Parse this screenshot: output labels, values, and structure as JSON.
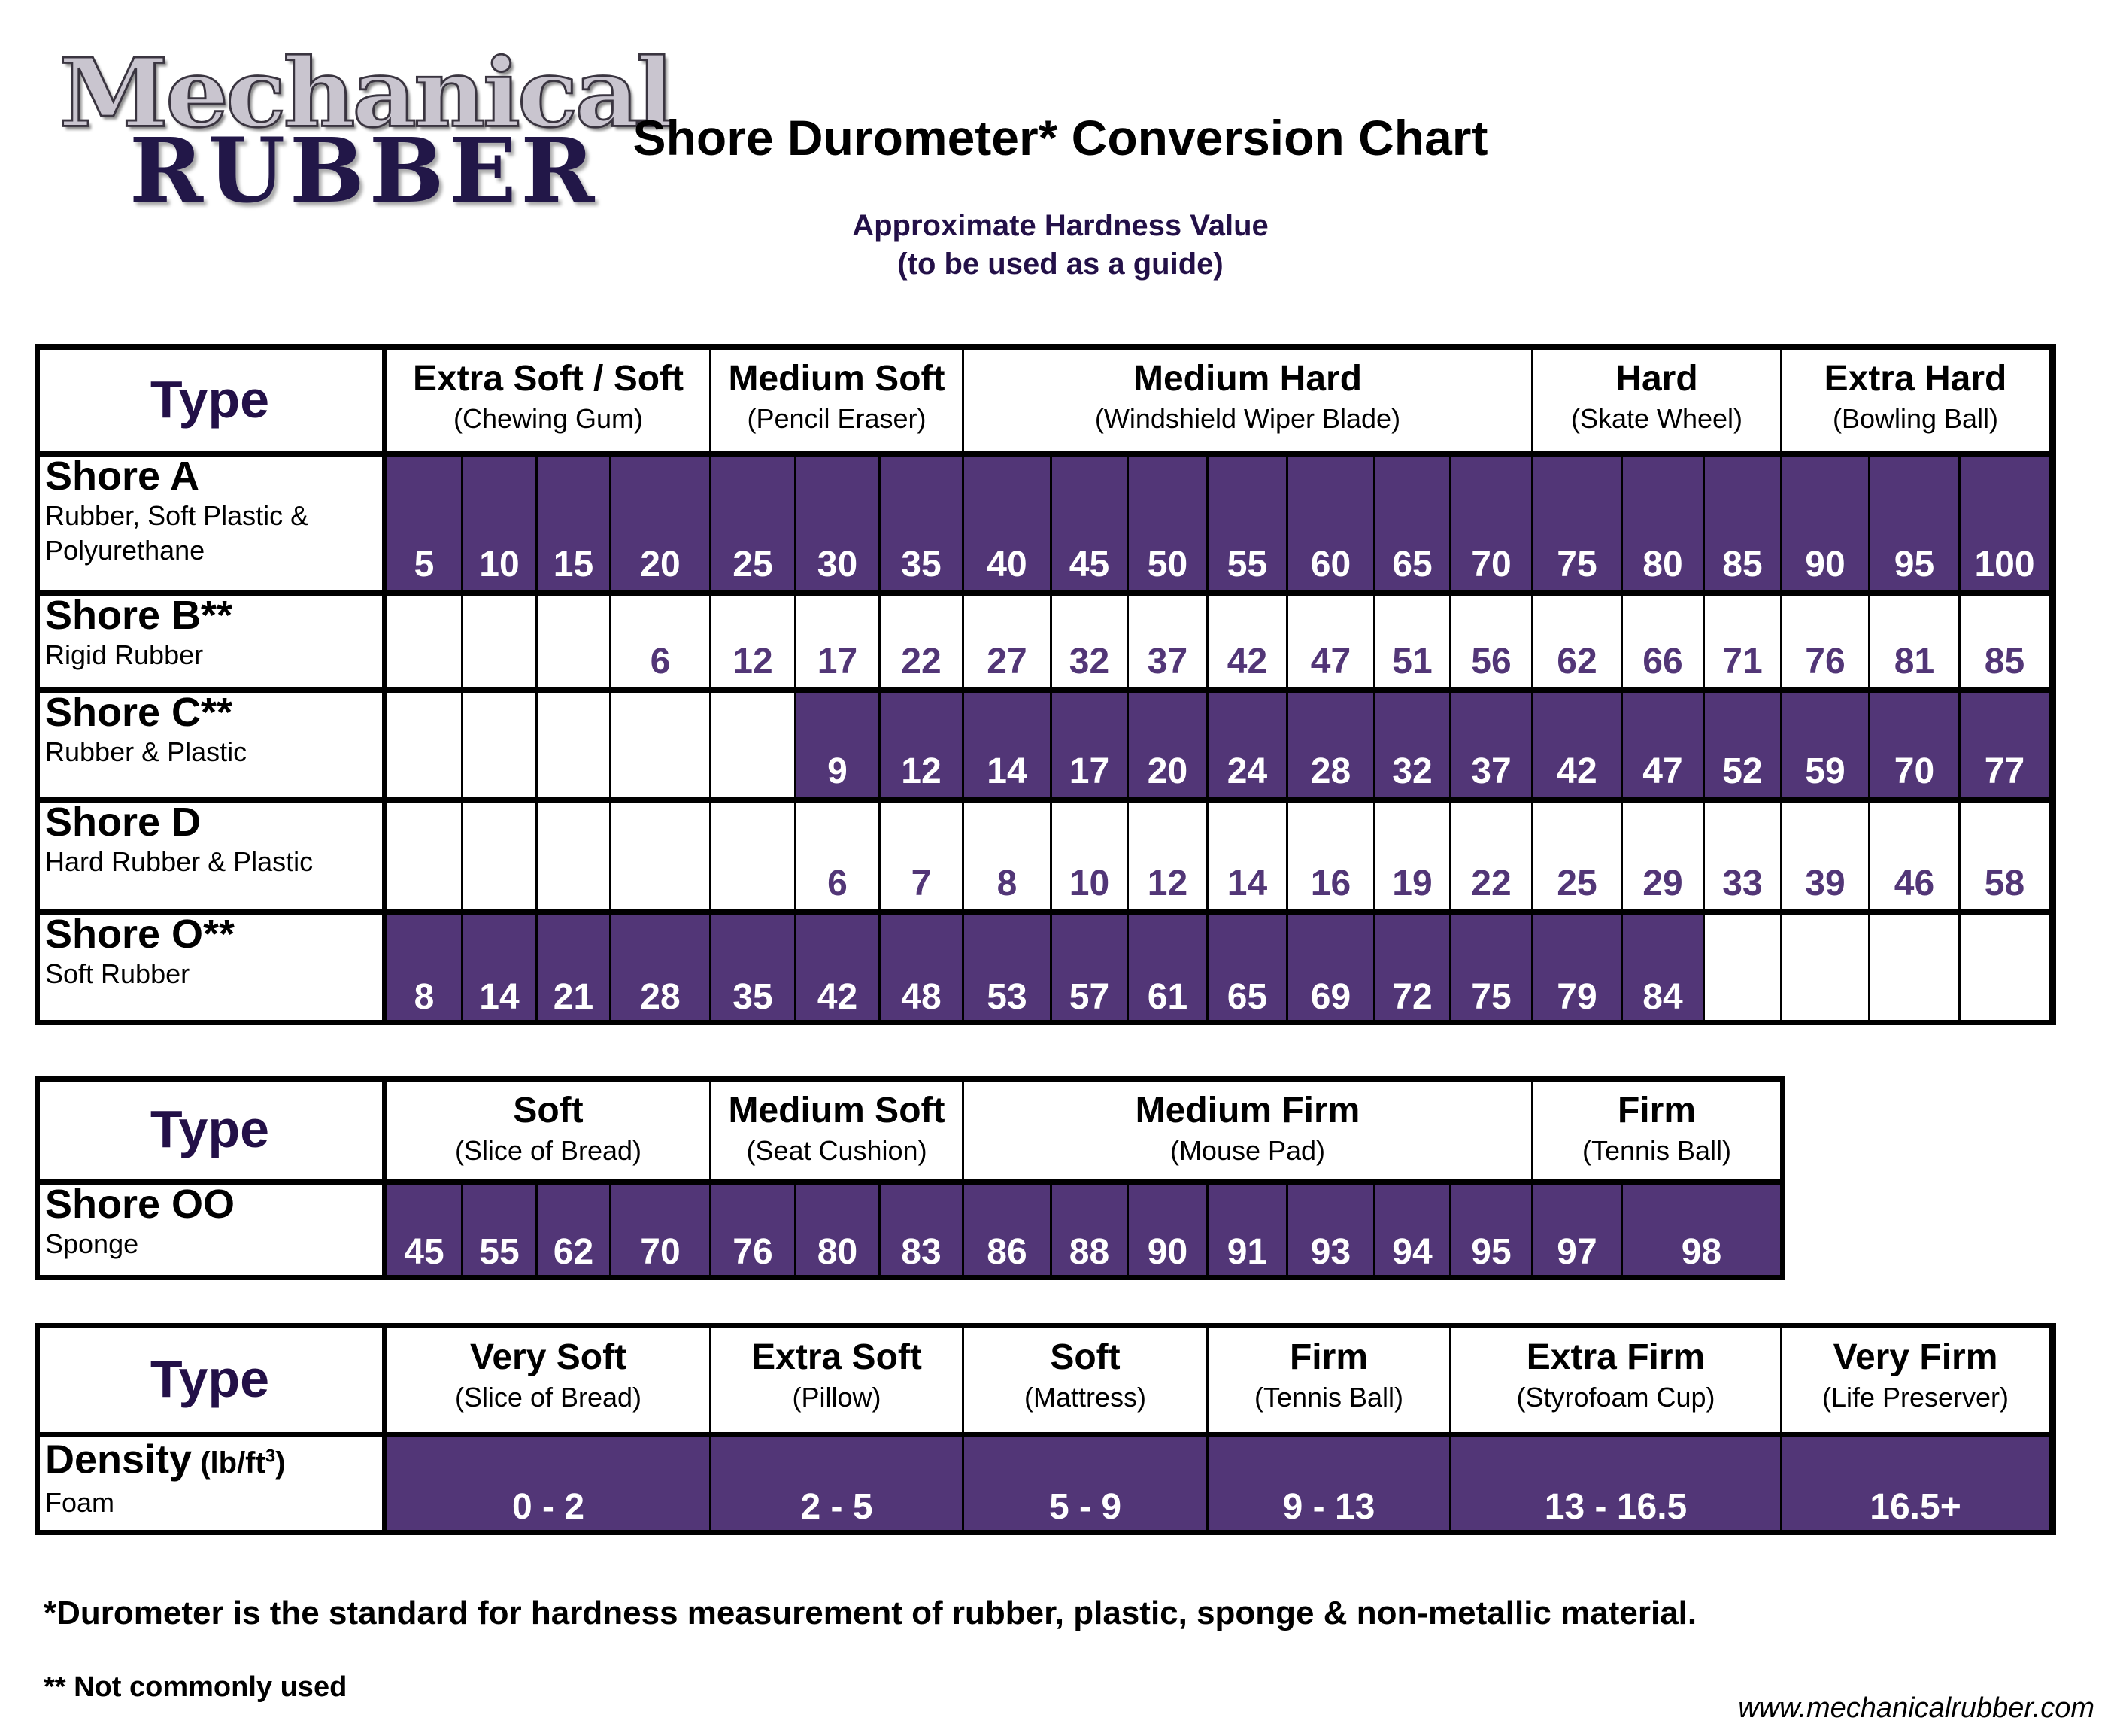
{
  "brand": {
    "logo_line1": "Mechanical",
    "logo_line2": "RUBBER"
  },
  "colors": {
    "accent_purple": "#523677",
    "type_text": "#231048",
    "logo_dark": "#221748",
    "logo_light": "#c9c5cf"
  },
  "header": {
    "title": "Shore Durometer* Conversion Chart",
    "subtitle_line1": "Approximate Hardness Value",
    "subtitle_line2": "(to be used as a guide)"
  },
  "shore_table": {
    "type_label": "Type",
    "categories": [
      {
        "name": "Extra Soft / Soft",
        "example": "(Chewing Gum)",
        "span": [
          0,
          4
        ]
      },
      {
        "name": "Medium Soft",
        "example": "(Pencil Eraser)",
        "span": [
          4,
          7
        ]
      },
      {
        "name": "Medium Hard",
        "example": "(Windshield Wiper Blade)",
        "span": [
          7,
          14
        ]
      },
      {
        "name": "Hard",
        "example": "(Skate Wheel)",
        "span": [
          14,
          17
        ]
      },
      {
        "name": "Extra Hard",
        "example": "(Bowling Ball)",
        "span": [
          17,
          20
        ]
      }
    ],
    "rows": [
      {
        "name": "Shore A",
        "sub": "Rubber, Soft Plastic & Polyurethane",
        "shaded": true,
        "values": [
          "5",
          "10",
          "15",
          "20",
          "25",
          "30",
          "35",
          "40",
          "45",
          "50",
          "55",
          "60",
          "65",
          "70",
          "75",
          "80",
          "85",
          "90",
          "95",
          "100"
        ]
      },
      {
        "name": "Shore B**",
        "sub": "Rigid Rubber",
        "shaded": false,
        "values": [
          "",
          "",
          "",
          "6",
          "12",
          "17",
          "22",
          "27",
          "32",
          "37",
          "42",
          "47",
          "51",
          "56",
          "62",
          "66",
          "71",
          "76",
          "81",
          "85"
        ]
      },
      {
        "name": "Shore C**",
        "sub": "Rubber & Plastic",
        "shaded": true,
        "values": [
          "",
          "",
          "",
          "",
          "",
          "9",
          "12",
          "14",
          "17",
          "20",
          "24",
          "28",
          "32",
          "37",
          "42",
          "47",
          "52",
          "59",
          "70",
          "77"
        ]
      },
      {
        "name": "Shore D",
        "sub": "Hard Rubber & Plastic",
        "shaded": false,
        "values": [
          "",
          "",
          "",
          "",
          "",
          "6",
          "7",
          "8",
          "10",
          "12",
          "14",
          "16",
          "19",
          "22",
          "25",
          "29",
          "33",
          "39",
          "46",
          "58"
        ]
      },
      {
        "name": "Shore O**",
        "sub": "Soft Rubber",
        "shaded": true,
        "values": [
          "8",
          "14",
          "21",
          "28",
          "35",
          "42",
          "48",
          "53",
          "57",
          "61",
          "65",
          "69",
          "72",
          "75",
          "79",
          "84",
          "",
          "",
          "",
          ""
        ]
      }
    ]
  },
  "sponge_table": {
    "type_label": "Type",
    "categories": [
      {
        "name": "Soft",
        "example": "(Slice of Bread)"
      },
      {
        "name": "Medium Soft",
        "example": "(Seat Cushion)"
      },
      {
        "name": "Medium Firm",
        "example": "(Mouse Pad)"
      },
      {
        "name": "Firm",
        "example": "(Tennis Ball)"
      }
    ],
    "row": {
      "name": "Shore OO",
      "sub": "Sponge",
      "values": [
        "45",
        "55",
        "62",
        "70",
        "76",
        "80",
        "83",
        "86",
        "88",
        "90",
        "91",
        "93",
        "94",
        "95",
        "97",
        "98"
      ]
    }
  },
  "density_table": {
    "type_label": "Type",
    "categories": [
      {
        "name": "Very Soft",
        "example": "(Slice of Bread)",
        "value": "0 - 2"
      },
      {
        "name": "Extra Soft",
        "example": "(Pillow)",
        "value": "2 - 5"
      },
      {
        "name": "Soft",
        "example": "(Mattress)",
        "value": "5 - 9"
      },
      {
        "name": "Firm",
        "example": "(Tennis Ball)",
        "value": "9 - 13"
      },
      {
        "name": "Extra Firm",
        "example": "(Styrofoam Cup)",
        "value": "13 - 16.5"
      },
      {
        "name": "Very Firm",
        "example": "(Life Preserver)",
        "value": "16.5+"
      }
    ],
    "row": {
      "name": "Density",
      "unit": "(lb/ft",
      "unit_sup": "3",
      "unit_close": ")",
      "sub": "Foam"
    }
  },
  "footer": {
    "note1": "*Durometer is the standard for hardness measurement of rubber, plastic, sponge & non-metallic material.",
    "note2": "** Not commonly used",
    "website": "www.mechanicalrubber.com"
  }
}
